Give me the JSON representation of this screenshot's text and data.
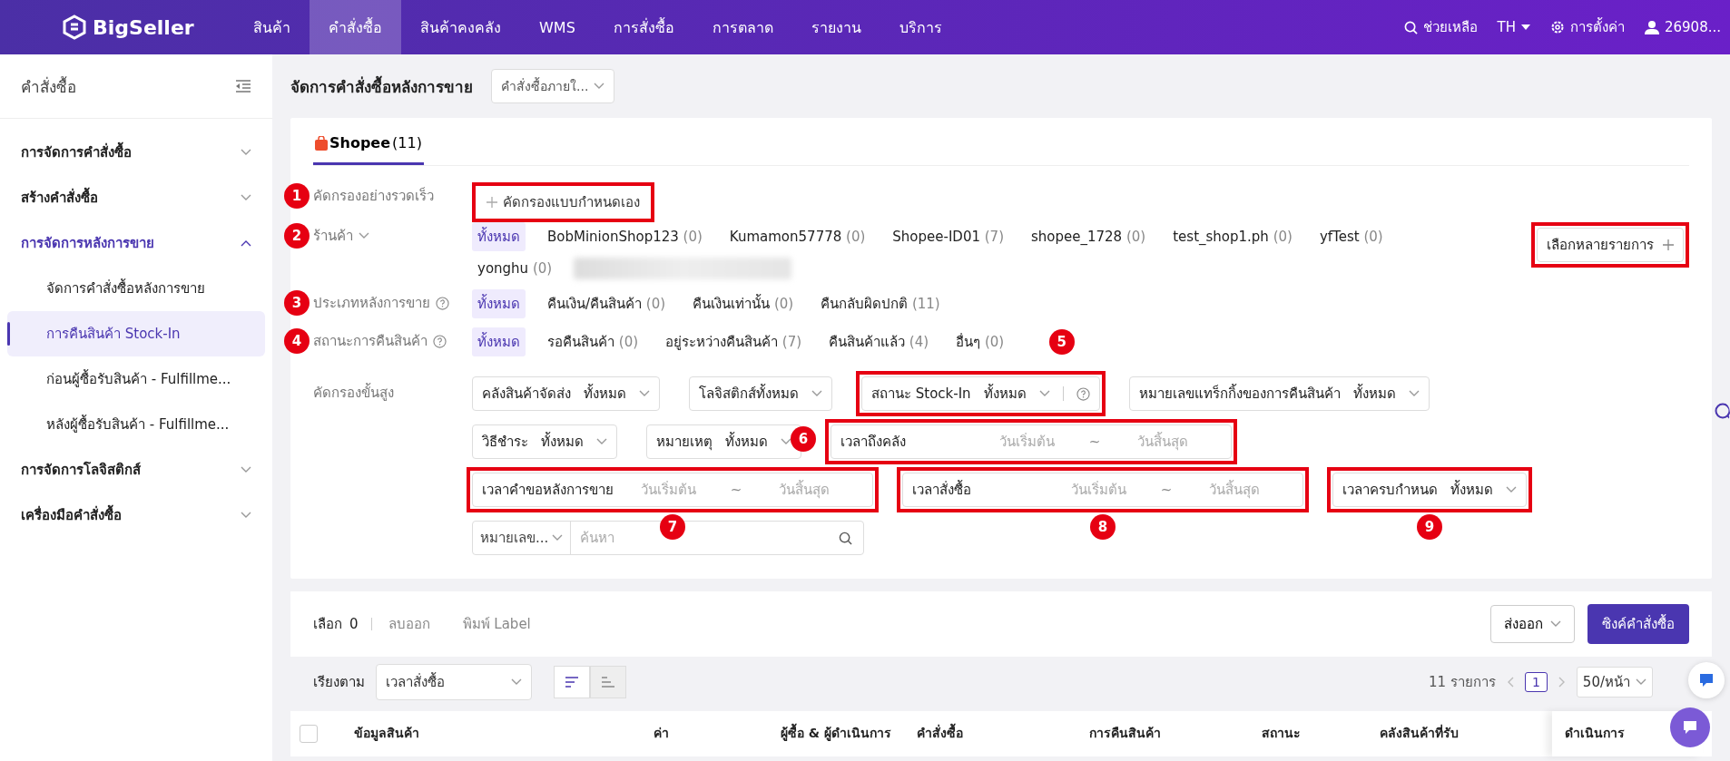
{
  "nav": {
    "logo": "BigSeller",
    "items": [
      {
        "label": "สินค้า",
        "selected": false
      },
      {
        "label": "คำสั่งซื้อ",
        "selected": true
      },
      {
        "label": "สินค้าคงคลัง",
        "selected": false
      },
      {
        "label": "WMS",
        "selected": false
      },
      {
        "label": "การสั่งซื้อ",
        "selected": false
      },
      {
        "label": "การตลาด",
        "selected": false
      },
      {
        "label": "รายงาน",
        "selected": false
      },
      {
        "label": "บริการ",
        "selected": false
      }
    ],
    "help": "ช่วยเหลือ",
    "language": "TH",
    "settings": "การตั้งค่า",
    "user": "26908..."
  },
  "sidebar": {
    "title": "คำสั่งซื้อ",
    "groups": [
      {
        "label": "การจัดการคำสั่งซื้อ",
        "expanded": false
      },
      {
        "label": "สร้างคำสั่งซื้อ",
        "expanded": false
      },
      {
        "label": "การจัดการหลังการขาย",
        "expanded": true,
        "children": [
          {
            "label": "จัดการคำสั่งซื้อหลังการขาย",
            "selected": false
          },
          {
            "label": "การคืนสินค้า Stock-In",
            "selected": true
          },
          {
            "label": "ก่อนผู้ซื้อรับสินค้า - Fulfillme...",
            "selected": false
          },
          {
            "label": "หลังผู้ซื้อรับสินค้า - Fulfillme...",
            "selected": false
          }
        ]
      },
      {
        "label": "การจัดการโลจิสติกส์",
        "expanded": false
      },
      {
        "label": "เครื่องมือคำสั่งซื้อ",
        "expanded": false
      }
    ]
  },
  "page": {
    "title": "จัดการคำสั่งซื้อหลังการขาย",
    "scope": "คำสั่งซื้อภายใ..."
  },
  "tabs": [
    {
      "label": "Shopee",
      "count": "(11)",
      "selected": true
    }
  ],
  "quick_filter": {
    "label": "คัดกรองอย่างรวดเร็ว",
    "badge": "1",
    "button": {
      "label": "คัดกรองแบบกำหนดเอง",
      "highlighted": true
    }
  },
  "option_rows": [
    {
      "label": "ร้านค้า",
      "badge": "2",
      "kind": "dropdown",
      "options": [
        {
          "label": "ทั้งหมด",
          "selected": true
        },
        {
          "label": "BobMinionShop123",
          "count": "(0)",
          "selected": false
        },
        {
          "label": "Kumamon57778",
          "count": "(0)",
          "selected": false
        },
        {
          "label": "Shopee-ID01",
          "count": "(7)",
          "selected": false
        },
        {
          "label": "shopee_1728",
          "count": "(0)",
          "selected": false
        },
        {
          "label": "test_shop1.ph",
          "count": "(0)",
          "selected": false
        },
        {
          "label": "yfTest",
          "count": "(0)",
          "selected": false
        },
        {
          "label": "yonghu",
          "count": "(0)",
          "selected": false
        }
      ],
      "multi_select": {
        "label": "เลือกหลายรายการ",
        "highlighted": true
      }
    },
    {
      "label": "ประเภทหลังการขาย",
      "badge": "3",
      "kind": "help",
      "options": [
        {
          "label": "ทั้งหมด",
          "selected": true
        },
        {
          "label": "คืนเงิน/คืนสินค้า",
          "count": "(0)",
          "selected": false
        },
        {
          "label": "คืนเงินเท่านั้น",
          "count": "(0)",
          "selected": false
        },
        {
          "label": "คืนกลับผิดปกติ",
          "count": "(11)",
          "selected": false
        }
      ]
    },
    {
      "label": "สถานะการคืนสินค้า",
      "badge": "4",
      "kind": "help",
      "options": [
        {
          "label": "ทั้งหมด",
          "selected": true
        },
        {
          "label": "รอคืนสินค้า",
          "count": "(0)",
          "selected": false
        },
        {
          "label": "อยู่ระหว่างคืนสินค้า",
          "count": "(7)",
          "selected": false
        },
        {
          "label": "คืนสินค้าแล้ว",
          "count": "(4)",
          "selected": false
        },
        {
          "label": "อื่นๆ",
          "count": "(0)",
          "selected": false
        }
      ]
    }
  ],
  "advanced": {
    "label": "คัดกรองขั้นสูง",
    "lines": [
      {
        "fields": [
          {
            "kind": "select",
            "label": "คลังสินค้าจัดส่ง",
            "value": "ทั้งหมด"
          },
          {
            "kind": "select",
            "label": "โลจิสติกส์ทั้งหมด"
          },
          {
            "kind": "select",
            "label": "สถานะ Stock-In",
            "value": "ทั้งหมด",
            "help": true,
            "highlighted": true,
            "badge": {
              "number": "5",
              "kind": "top"
            }
          },
          {
            "kind": "select",
            "label": "หมายเลขแทร็กกิ้งของการคืนสินค้า",
            "value": "ทั้งหมด"
          }
        ]
      },
      {
        "fields": [
          {
            "kind": "select",
            "label": "วิธีชำระ",
            "value": "ทั้งหมด"
          },
          {
            "kind": "select",
            "label": "หมายเหตุ",
            "value": "ทั้งหมด"
          },
          {
            "kind": "date",
            "label": "เวลาถึงคลัง",
            "start": "วันเริ่มต้น",
            "separator": "~",
            "end": "วันสิ้นสุด",
            "highlighted": true,
            "badge": {
              "number": "6",
              "kind": "left"
            }
          }
        ]
      },
      {
        "fields": [
          {
            "kind": "date",
            "label": "เวลาคำขอหลังการขาย",
            "start": "วันเริ่มต้น",
            "separator": "~",
            "end": "วันสิ้นสุด",
            "highlighted": true,
            "badge": {
              "number": "7",
              "kind": "bottom"
            }
          },
          {
            "kind": "date",
            "label": "เวลาสั่งซื้อ",
            "start": "วันเริ่มต้น",
            "separator": "~",
            "end": "วันสิ้นสุด",
            "highlighted": true,
            "badge": {
              "number": "8",
              "kind": "bottom"
            }
          },
          {
            "kind": "select",
            "label": "เวลาครบกำหนด",
            "value": "ทั้งหมด",
            "highlighted": true,
            "badge": {
              "number": "9",
              "kind": "bottom"
            }
          }
        ]
      },
      {
        "fields": [
          {
            "kind": "search",
            "type": "หมายเลข...",
            "placeholder": "ค้นหา"
          }
        ]
      }
    ]
  },
  "actions": {
    "select_label": "เลือก",
    "selected_count": "0",
    "delete": "ลบออก",
    "print": "พิมพ์ Label",
    "export": "ส่งออก",
    "sync": "ซิงค์คำสั่งซื้อ"
  },
  "sort": {
    "label": "เรียงตาม",
    "value": "เวลาสั่งซื้อ",
    "buttons": [
      {
        "kind": "desc",
        "selected": true
      },
      {
        "kind": "asc",
        "selected": false
      }
    ]
  },
  "pagination": {
    "total": "11 รายการ",
    "page": "1",
    "per_page": "50/หน้า"
  },
  "table": {
    "select_all_checked": false,
    "columns": [
      "ข้อมูลสินค้า",
      "ค่า",
      "ผู้ซื้อ & ผู้ดำเนินการ",
      "คำสั่งซื้อ",
      "การคืนสินค้า",
      "สถานะ",
      "คลังสินค้าที่รับ",
      "ดำเนินการ"
    ]
  }
}
